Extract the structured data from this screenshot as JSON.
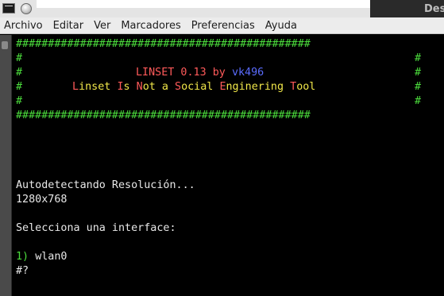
{
  "window": {
    "title": "Des"
  },
  "menu": [
    "Archivo",
    "Editar",
    "Ver",
    "Marcadores",
    "Preferencias",
    "Ayuda"
  ],
  "banner": {
    "border": "##############################################",
    "side": "#",
    "app_name": "LINSET 0.13",
    "by": "by",
    "author": "vk496",
    "tagline_words": [
      {
        "cap": "L",
        "rest": "inset"
      },
      {
        "cap": "I",
        "rest": "s"
      },
      {
        "cap": "N",
        "rest": "ot"
      },
      {
        "cap": "a",
        "rest": ""
      },
      {
        "cap": "S",
        "rest": "ocial"
      },
      {
        "cap": "E",
        "rest": "nginering"
      },
      {
        "cap": "T",
        "rest": "ool"
      }
    ]
  },
  "output": {
    "detecting": "Autodetectando Resolución...",
    "resolution": "1280x768",
    "select_prompt": "Selecciona una interface:",
    "option_index": "1)",
    "option_name": "wlan0",
    "input_prompt": "#?"
  },
  "colors": {
    "border_green": "#4bdc3c",
    "title_red": "#ff5a5a",
    "tagline_yellow": "#f2e84a",
    "author_blue": "#5b6cff",
    "background": "#000000"
  }
}
